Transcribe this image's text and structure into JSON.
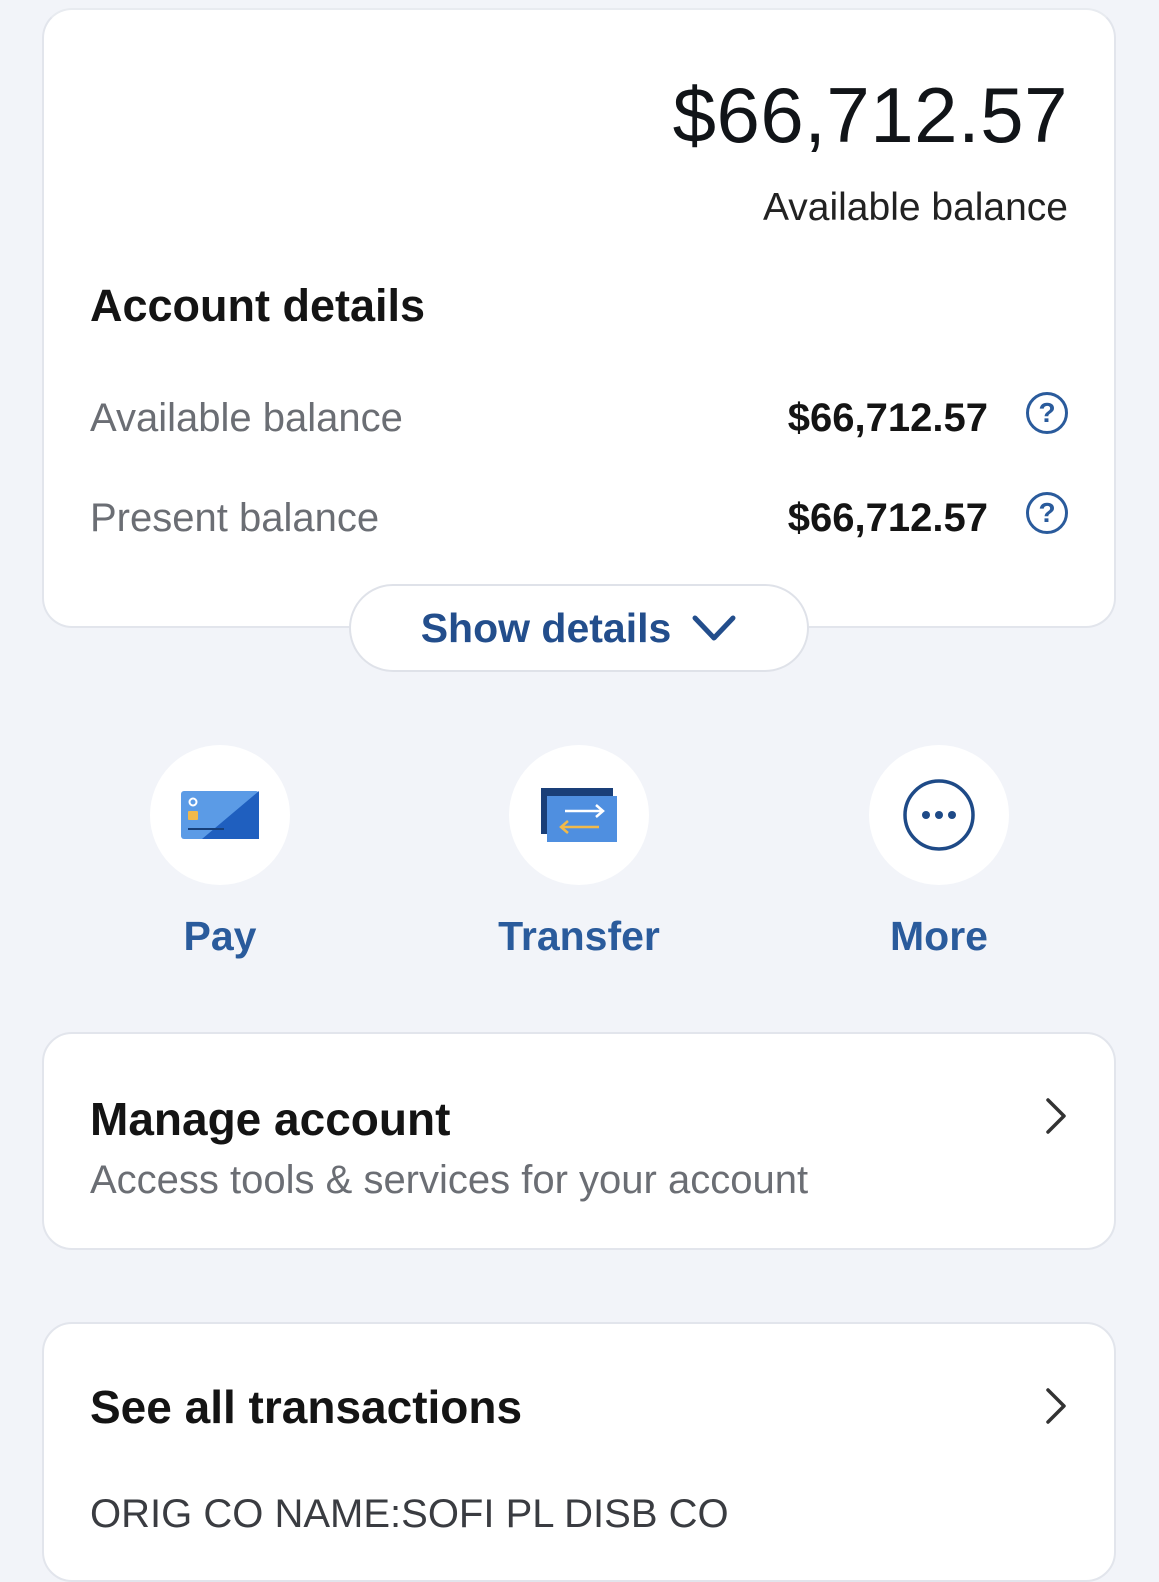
{
  "balance_card": {
    "amount": "$66,712.57",
    "amount_label": "Available balance",
    "section_title": "Account details",
    "rows": [
      {
        "label": "Available balance",
        "value": "$66,712.57",
        "help": "?"
      },
      {
        "label": "Present balance",
        "value": "$66,712.57",
        "help": "?"
      }
    ]
  },
  "show_details": {
    "label": "Show details"
  },
  "actions": [
    {
      "label": "Pay",
      "icon": "card-icon"
    },
    {
      "label": "Transfer",
      "icon": "transfer-icon"
    },
    {
      "label": "More",
      "icon": "more-icon"
    }
  ],
  "manage": {
    "title": "Manage account",
    "subtitle": "Access tools & services for your account"
  },
  "transactions": {
    "title": "See all transactions",
    "first_item": "ORIG CO NAME:SOFI PL DISB CO"
  },
  "colors": {
    "accent": "#2a5b9c",
    "background": "#f2f4f9",
    "card": "#ffffff"
  }
}
